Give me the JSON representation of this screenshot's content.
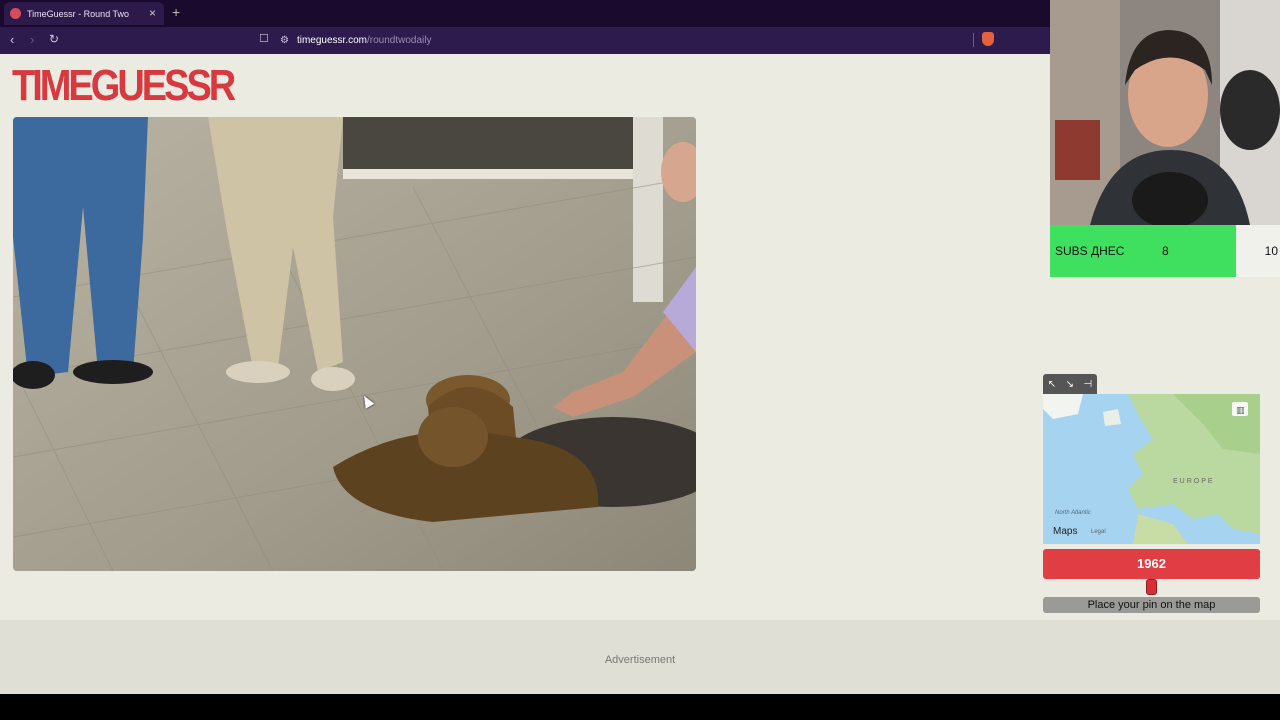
{
  "browser": {
    "tab_title": "TimeGuessr - Round Two",
    "url_domain": "timeguessr.com",
    "url_path": "/roundtwodaily",
    "theme_color": "#2d1b4e"
  },
  "site": {
    "logo_text": "TIMEGUESSR",
    "logo_color": "#d8393f",
    "advertisement_label": "Advertisement"
  },
  "overlay": {
    "subs_label": "SUBS ДНЕС",
    "subs_count": "8",
    "subs_goal": "10",
    "subs_color": "#3fe05f"
  },
  "guess_panel": {
    "map_region_label": "EUROPE",
    "ocean_label": "North Atlantic",
    "maps_brand": "Maps",
    "legal_label": "Legal",
    "year_value": "1962",
    "year_color": "#e03d45",
    "place_pin_label": "Place your pin on the map"
  }
}
